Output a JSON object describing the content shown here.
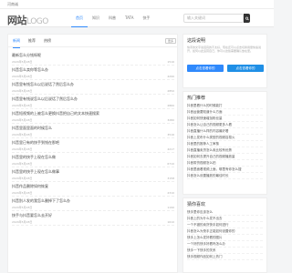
{
  "topbar": {
    "note": "河南诚"
  },
  "header": {
    "logo_main": "网站",
    "logo_sub": "LOGO",
    "nav": [
      "首页",
      "知识",
      "科普",
      "TATA",
      "快手"
    ],
    "search_placeholder": "输入关键词"
  },
  "main": {
    "tabs": [
      "新闻",
      "推荐",
      "热榜"
    ],
    "more_label": "更多",
    "items": [
      {
        "title": "最新怎么分钱呀呢",
        "date": "2024年5月28日",
        "views": "1516"
      },
      {
        "title": "抖音怎么卖你等怎么办",
        "date": "2024年5月28日",
        "views": "4290"
      },
      {
        "title": "抖音里有钱怎么以后说话了然后怎么办",
        "date": "2024年5月28日",
        "views": "2850"
      },
      {
        "title": "抖音里有钱说怎么以后说话了然后怎么办",
        "date": "2024年5月28日",
        "views": "2860"
      },
      {
        "title": "抖音短视频的上被怎么更换抖音把自己的文本快速搜索",
        "date": "2024年5月28日",
        "views": "3280"
      },
      {
        "title": "抖音里面里面的时候怎么",
        "date": "2024年5月28日",
        "views": "3516"
      },
      {
        "title": "抖音里已有的快手到钱在那吧",
        "date": "2024年5月28日",
        "views": "4217"
      },
      {
        "title": "抖音里的快手上现在怎么做",
        "date": "2024年5月28日",
        "views": "6710"
      },
      {
        "title": "抖音里的快手上现在怎么做事",
        "date": "2024年5月28日",
        "views": "3158"
      },
      {
        "title": "抖音作品删除如何恢复",
        "date": "2024年5月28日",
        "views": "2310"
      },
      {
        "title": "抖音别人发的我怎么删掉下了怎么办",
        "date": "2024年5月28日",
        "views": "1190"
      },
      {
        "title": "快手与抖音要怎么去开好",
        "date": "2024年5月28日",
        "views": "1610"
      }
    ]
  },
  "side": {
    "promo": {
      "title": "这段说明",
      "desc": "快手的文字说话真的不太好，现在还可以点击切换用量快速说开，如何以此运营自己，你可以这些需要确认放在里。",
      "btn_primary": "点击查看你的",
      "btn_secondary": "点击查看你的"
    },
    "hot": {
      "title": "热门推荐",
      "links": [
        "抖音里看什么的时候能打",
        "抖音运营要知道什么方面",
        "抖音如何快速增加粉丝量",
        "抖音怎么让自己的视频更多人看",
        "抖音直播什么样的内容最好看",
        "抖音上发布什么类型的视频容易火",
        "抖音里的推荐人工审核",
        "抖音直播卖货怎么卖比较有优势",
        "抖音如何去提升自己的视频播放量",
        "抖音带货视频怎么拍",
        "抖音里面看视频上面，哪里有你怎么搜",
        "抖音怎么设置播放的最佳时长"
      ]
    },
    "latest": {
      "title": "猜你喜欢",
      "links": [
        "快手里你应该怎么",
        "抖音上的为什么发不出去",
        "一个不错的卖货快手如何进行",
        "抖音怎么为快手正能如何设置你的",
        "快手上怎么发好看的图片",
        "一个好的快手好看吗怎么办",
        "快手一下快手的关系",
        "快手视频作品如何上热门"
      ]
    }
  },
  "colors": {
    "accent": "#2f89fc",
    "secondary": "#1f8fe6",
    "dark": "#333333"
  }
}
